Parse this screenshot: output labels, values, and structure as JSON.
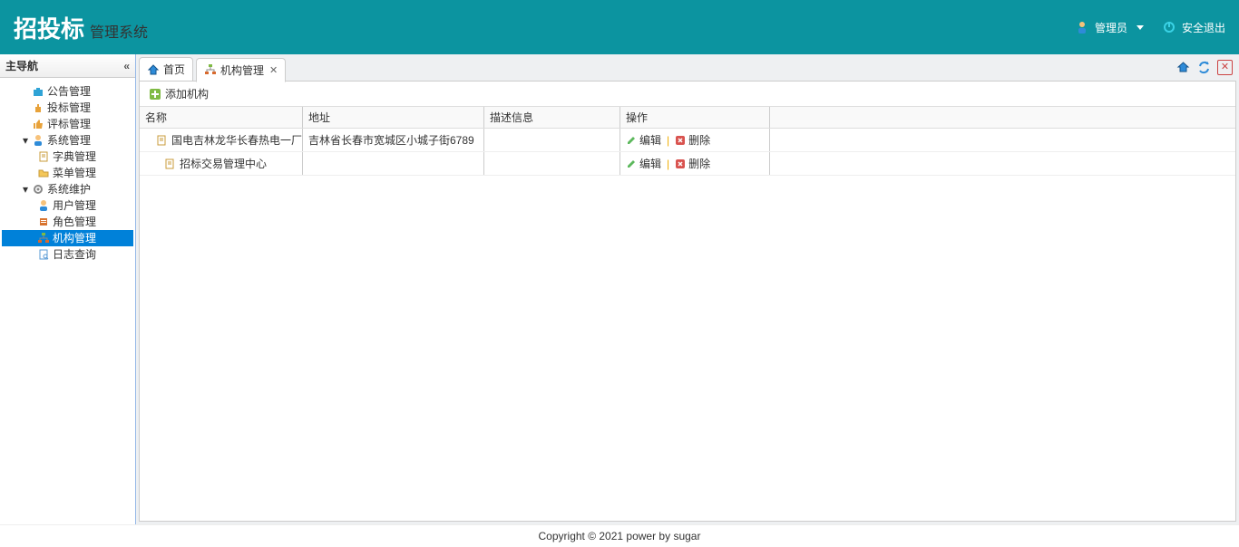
{
  "header": {
    "title_main": "招投标",
    "title_sub": "管理系统",
    "user_label": "管理员",
    "logout_label": "安全退出"
  },
  "sidebar": {
    "title": "主导航",
    "nodes": [
      {
        "id": "announcement",
        "label": "公告管理",
        "indent": 1,
        "icon": "briefcase",
        "leaf": true
      },
      {
        "id": "bid",
        "label": "投标管理",
        "indent": 1,
        "icon": "hand",
        "leaf": true
      },
      {
        "id": "eval",
        "label": "评标管理",
        "indent": 1,
        "icon": "thumb",
        "leaf": true
      },
      {
        "id": "sysmgmt",
        "label": "系统管理",
        "indent": 1,
        "icon": "user",
        "leaf": false,
        "expanded": true
      },
      {
        "id": "dict",
        "label": "字典管理",
        "indent": 2,
        "icon": "doc",
        "leaf": true
      },
      {
        "id": "menu",
        "label": "菜单管理",
        "indent": 2,
        "icon": "folder",
        "leaf": true
      },
      {
        "id": "sysmaint",
        "label": "系统维护",
        "indent": 1,
        "icon": "gear",
        "leaf": false,
        "expanded": true
      },
      {
        "id": "users",
        "label": "用户管理",
        "indent": 2,
        "icon": "user",
        "leaf": true
      },
      {
        "id": "roles",
        "label": "角色管理",
        "indent": 2,
        "icon": "role",
        "leaf": true
      },
      {
        "id": "org",
        "label": "机构管理",
        "indent": 2,
        "icon": "org",
        "leaf": true,
        "selected": true
      },
      {
        "id": "logs",
        "label": "日志查询",
        "indent": 2,
        "icon": "log",
        "leaf": true
      }
    ]
  },
  "tabs": {
    "home_label": "首页",
    "current_label": "机构管理"
  },
  "toolbar": {
    "add_label": "添加机构"
  },
  "grid": {
    "headers": {
      "name": "名称",
      "address": "地址",
      "desc": "描述信息",
      "op": "操作"
    },
    "op_edit": "编辑",
    "op_delete": "删除",
    "rows": [
      {
        "name": "国电吉林龙华长春热电一厂",
        "address": "吉林省长春市宽城区小城子街6789",
        "desc": ""
      },
      {
        "name": "招标交易管理中心",
        "address": "",
        "desc": ""
      }
    ]
  },
  "footer": {
    "text": "Copyright © 2021 power by sugar"
  }
}
